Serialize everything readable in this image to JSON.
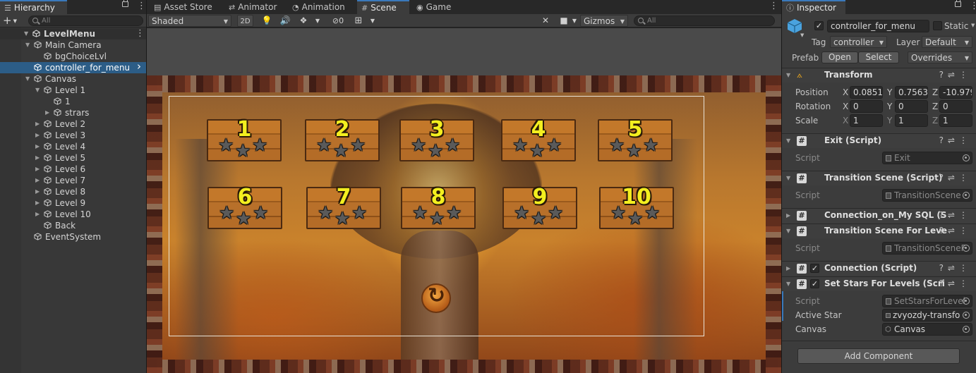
{
  "hierarchy": {
    "tab": "Hierarchy",
    "search_placeholder": "All",
    "scene_name": "LevelMenu",
    "items": [
      {
        "label": "Main Camera"
      },
      {
        "label": "bgChoiceLvl"
      },
      {
        "label": "controller_for_menu"
      },
      {
        "label": "Canvas"
      },
      {
        "label": "Level 1"
      },
      {
        "label": "1"
      },
      {
        "label": "strars"
      },
      {
        "label": "Level 2"
      },
      {
        "label": "Level 3"
      },
      {
        "label": "Level 4"
      },
      {
        "label": "Level 5"
      },
      {
        "label": "Level 6"
      },
      {
        "label": "Level 7"
      },
      {
        "label": "Level 8"
      },
      {
        "label": "Level 9"
      },
      {
        "label": "Level 10"
      },
      {
        "label": "Back"
      },
      {
        "label": "EventSystem"
      }
    ]
  },
  "tabs": {
    "asset_store": "Asset Store",
    "animator": "Animator",
    "animation": "Animation",
    "scene": "Scene",
    "game": "Game"
  },
  "scene_toolbar": {
    "shading": "Shaded",
    "mode_2d": "2D",
    "hidden_count": "0",
    "gizmos": "Gizmos",
    "search_placeholder": "All"
  },
  "game": {
    "levels": [
      "1",
      "2",
      "3",
      "4",
      "5",
      "6",
      "7",
      "8",
      "9",
      "10"
    ],
    "star_glyph": "★",
    "star_color": "#5a5a5a",
    "number_color": "#f3ef1f"
  },
  "inspector": {
    "tab": "Inspector",
    "object_name": "controller_for_menu",
    "static_label": "Static",
    "tag_label": "Tag",
    "tag_value": "controller",
    "layer_label": "Layer",
    "layer_value": "Default",
    "prefab_label": "Prefab",
    "open_btn": "Open",
    "select_btn": "Select",
    "overrides_btn": "Overrides",
    "transform": {
      "title": "Transform",
      "position_label": "Position",
      "rotation_label": "Rotation",
      "scale_label": "Scale",
      "position": {
        "x": "0.0851",
        "y": "0.7563",
        "z": "-10.979"
      },
      "rotation": {
        "x": "0",
        "y": "0",
        "z": "0"
      },
      "scale": {
        "x": "1",
        "y": "1",
        "z": "1"
      }
    },
    "components": {
      "exit": {
        "title": "Exit (Script)",
        "script_label": "Script",
        "script": "Exit"
      },
      "transition": {
        "title": "Transition Scene (Script)",
        "script_label": "Script",
        "script": "TransitionScene"
      },
      "connection_sql": {
        "title": "Connection_on_My SQL (S"
      },
      "transition_level": {
        "title": "Transition Scene For Leve",
        "script_label": "Script",
        "script": "TransitionSceneF"
      },
      "connection": {
        "title": "Connection (Script)"
      },
      "set_stars": {
        "title": "Set Stars For Levels (Scri",
        "script_label": "Script",
        "script": "SetStarsForLevel",
        "active_star_label": "Active Star",
        "active_star": "zvyozdy-transfo",
        "canvas_label": "Canvas",
        "canvas": "Canvas"
      }
    },
    "add_component": "Add Component"
  },
  "colors": {
    "selection": "#2c5d87",
    "accent": "#3a79bb"
  }
}
